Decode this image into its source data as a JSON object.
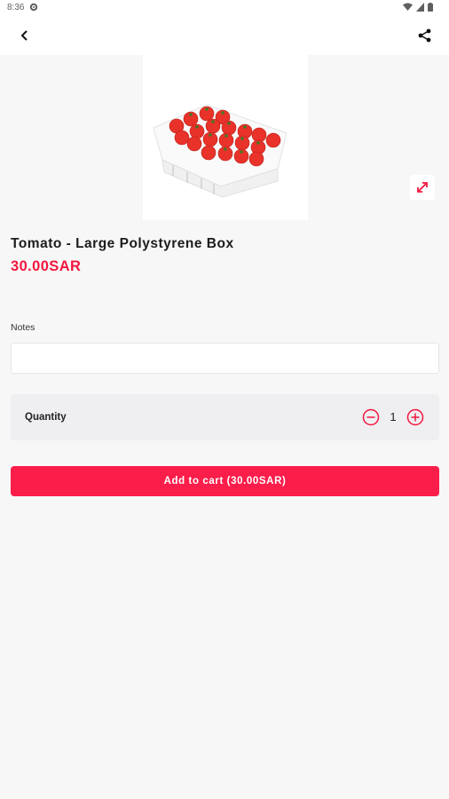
{
  "status_bar": {
    "time": "8:36",
    "icons": [
      "gear-icon",
      "wifi-icon",
      "signal-icon",
      "battery-icon"
    ]
  },
  "app_bar": {
    "back_icon": "chevron-left-icon",
    "share_icon": "share-icon"
  },
  "product": {
    "image_alt": "tomatoes-in-polystyrene-box",
    "expand_icon": "expand-arrows-icon",
    "title": "Tomato - Large Polystyrene Box",
    "price": "30.00SAR"
  },
  "notes": {
    "label": "Notes",
    "value": "",
    "placeholder": ""
  },
  "quantity": {
    "label": "Quantity",
    "value": "1",
    "minus_icon": "minus-circle-icon",
    "plus_icon": "plus-circle-icon"
  },
  "cart": {
    "button_label": "Add to cart (30.00SAR)"
  },
  "colors": {
    "accent": "#fb1d4a",
    "price": "#f2173f",
    "background": "#f7f7f7"
  }
}
